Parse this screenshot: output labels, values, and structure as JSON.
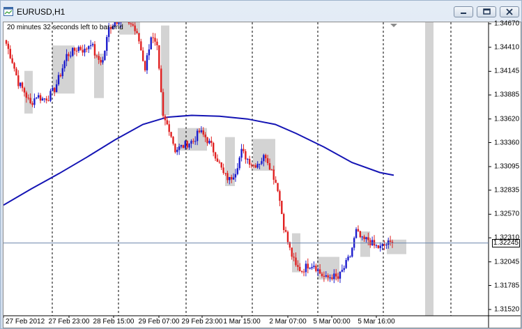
{
  "window": {
    "title": "EURUSD,H1",
    "minimize_icon": "minimize-icon",
    "restore_icon": "restore-icon",
    "close_icon": "close-icon"
  },
  "chart": {
    "countdown_text": "20 minutes 32 seconds left to bar end",
    "current_price": "1.32245",
    "colors": {
      "bull": "#1c1ccc",
      "bear": "#e02020",
      "ma": "#1414b4",
      "highlight": "#d3d3d3",
      "grid": "#000000"
    }
  },
  "chart_data": {
    "type": "candlestick",
    "symbol": "EURUSD",
    "timeframe": "H1",
    "price_ticks": [
      "1.34670",
      "1.34410",
      "1.34145",
      "1.33885",
      "1.33620",
      "1.33360",
      "1.33095",
      "1.32835",
      "1.32570",
      "1.32310",
      "1.32045",
      "1.31785",
      "1.31520"
    ],
    "time_ticks": [
      "27 Feb 2012",
      "27 Feb 23:00",
      "28 Feb 15:00",
      "29 Feb 07:00",
      "29 Feb 23:00",
      "1 Mar 15:00",
      "2 Mar 07:00",
      "5 Mar 00:00",
      "5 Mar 16:00"
    ],
    "ylim": [
      1.3146,
      1.3484
    ],
    "close_path": [
      1.3445,
      1.3426,
      1.3402,
      1.3392,
      1.3378,
      1.3388,
      1.3384,
      1.3386,
      1.3395,
      1.3412,
      1.3432,
      1.3436,
      1.3441,
      1.3437,
      1.3447,
      1.3428,
      1.3426,
      1.3462,
      1.3469,
      1.3474,
      1.3471,
      1.3465,
      1.3448,
      1.3418,
      1.3454,
      1.3439,
      1.3363,
      1.3352,
      1.3328,
      1.3331,
      1.3335,
      1.3338,
      1.3348,
      1.3342,
      1.3332,
      1.3318,
      1.3301,
      1.3295,
      1.3305,
      1.3326,
      1.3318,
      1.3311,
      1.3315,
      1.3322,
      1.3305,
      1.3286,
      1.3244,
      1.3218,
      1.3199,
      1.3195,
      1.3201,
      1.3202,
      1.3192,
      1.3186,
      1.3189,
      1.3186,
      1.3198,
      1.3211,
      1.3238,
      1.3228,
      1.3229,
      1.3222,
      1.322,
      1.3224,
      1.3225
    ],
    "moving_average": [
      [
        0,
        1.3267
      ],
      [
        40,
        1.3285
      ],
      [
        80,
        1.3302
      ],
      [
        120,
        1.332
      ],
      [
        160,
        1.3339
      ],
      [
        200,
        1.3356
      ],
      [
        235,
        1.3364
      ],
      [
        270,
        1.3366
      ],
      [
        310,
        1.3365
      ],
      [
        350,
        1.3362
      ],
      [
        390,
        1.3356
      ],
      [
        420,
        1.3346
      ],
      [
        460,
        1.3331
      ],
      [
        500,
        1.3314
      ],
      [
        540,
        1.3303
      ],
      [
        560,
        1.33
      ]
    ],
    "vertical_separators": [
      "27 Feb 23:00",
      "28 Feb 15:00",
      "29 Feb 07:00",
      "29 Feb 23:00",
      "1 Mar 15:00",
      "2 Mar 07:00",
      "5 Mar 00:00",
      "5 Mar 16:00",
      "5 Mar 16:00+"
    ],
    "grid": false
  }
}
